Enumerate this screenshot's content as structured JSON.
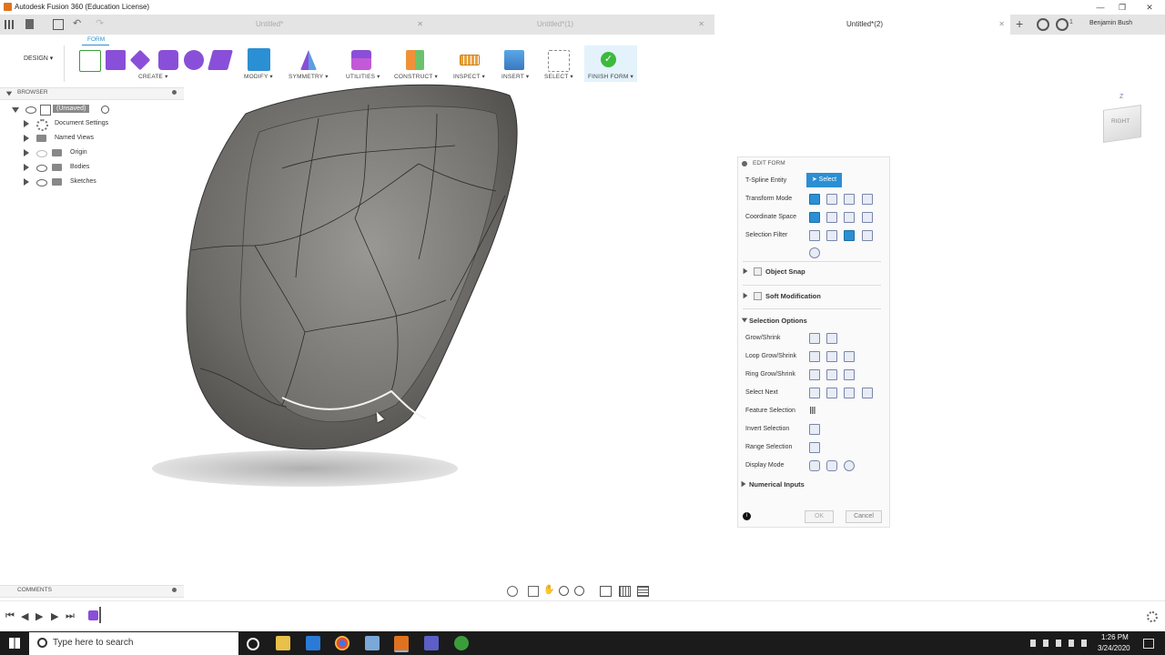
{
  "window": {
    "title": "Autodesk Fusion 360 (Education License)",
    "user": "Benjamin Bush",
    "notif_count": "1"
  },
  "tabs": [
    {
      "label": "Untitled*"
    },
    {
      "label": "Untitled*(1)"
    },
    {
      "label": "Untitled*(2)"
    }
  ],
  "toolbar": {
    "mode_tab": "FORM",
    "workspace": "DESIGN",
    "groups": [
      "CREATE",
      "MODIFY",
      "SYMMETRY",
      "UTILITIES",
      "CONSTRUCT",
      "INSPECT",
      "INSERT",
      "SELECT",
      "FINISH FORM"
    ]
  },
  "browser": {
    "title": "BROWSER",
    "root": "(Unsaved)",
    "items": [
      "Document Settings",
      "Named Views",
      "Origin",
      "Bodies",
      "Sketches"
    ]
  },
  "comments": {
    "title": "COMMENTS"
  },
  "viewcube": {
    "face": "RIGHT",
    "axis": "Z"
  },
  "edit_form": {
    "title": "EDIT FORM",
    "tspline_entity_label": "T-Spline Entity",
    "select_button": "Select",
    "transform_mode": "Transform Mode",
    "coordinate_space": "Coordinate Space",
    "selection_filter": "Selection Filter",
    "object_snap": "Object Snap",
    "soft_modification": "Soft Modification",
    "selection_options": "Selection Options",
    "rows": [
      "Grow/Shrink",
      "Loop Grow/Shrink",
      "Ring Grow/Shrink",
      "Select Next",
      "Feature Selection",
      "Invert  Selection",
      "Range  Selection",
      "Display Mode"
    ],
    "numerical_inputs": "Numerical Inputs",
    "ok": "OK",
    "cancel": "Cancel"
  },
  "taskbar": {
    "search_placeholder": "Type here to search",
    "time": "1:26 PM",
    "date": "3/24/2020"
  },
  "colors": {
    "accent": "#2b8fd3",
    "finish": "#3cba3c",
    "form_purple": "#8a4fd8",
    "taskbar": "#1b1b1b"
  }
}
